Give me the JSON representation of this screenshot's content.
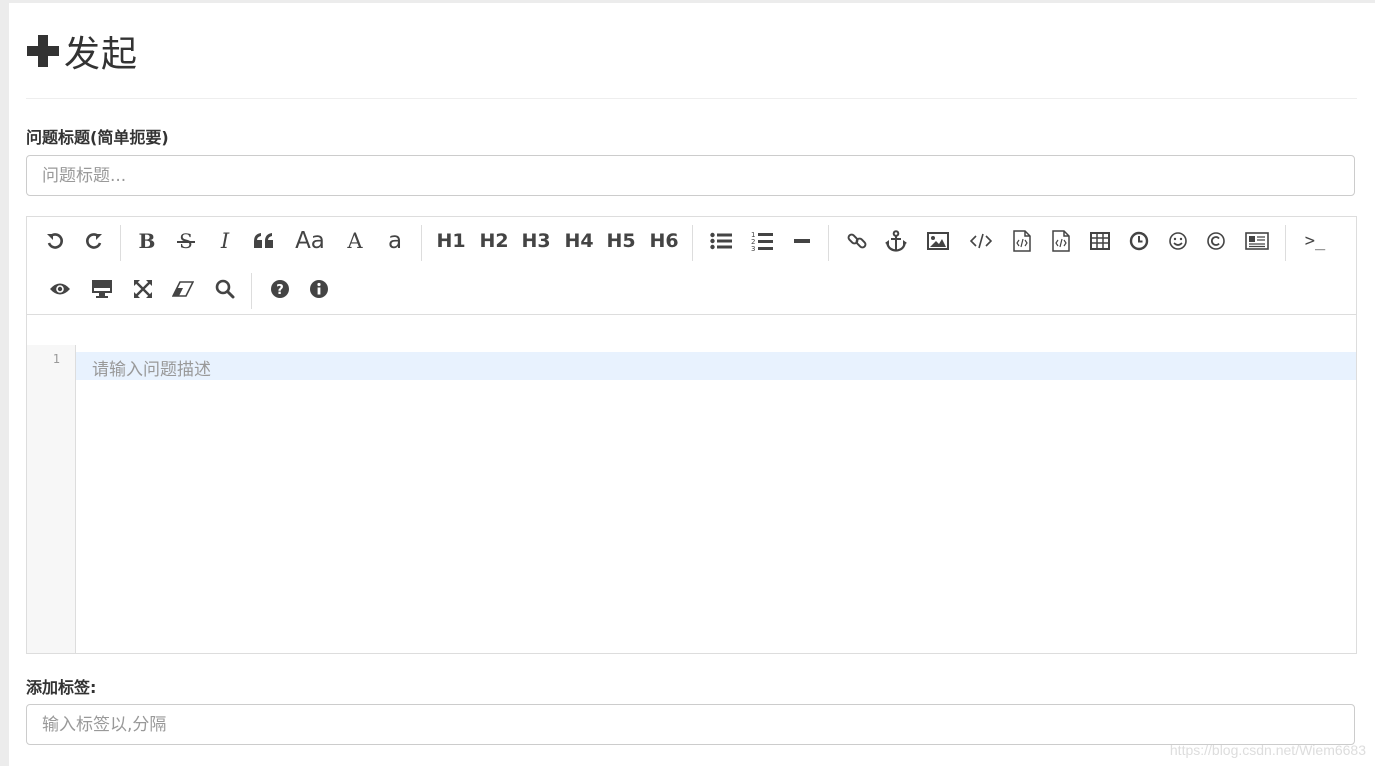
{
  "header": {
    "title": "发起"
  },
  "title_field": {
    "label": "问题标题(简单扼要)",
    "placeholder": "问题标题..."
  },
  "editor": {
    "toolbar": {
      "headings": [
        "H1",
        "H2",
        "H3",
        "H4",
        "H5",
        "H6"
      ],
      "font_sizes": [
        "Aa",
        "A",
        "a"
      ],
      "terminal_label": ">_"
    },
    "line_number": "1",
    "placeholder": "请输入问题描述"
  },
  "tags_field": {
    "label": "添加标签:",
    "placeholder": "输入标签以,分隔"
  },
  "watermark": "https://blog.csdn.net/Wiem6683",
  "colors": {
    "icon": "#444444",
    "active_line": "#e8f2fe",
    "border": "#dddddd"
  }
}
